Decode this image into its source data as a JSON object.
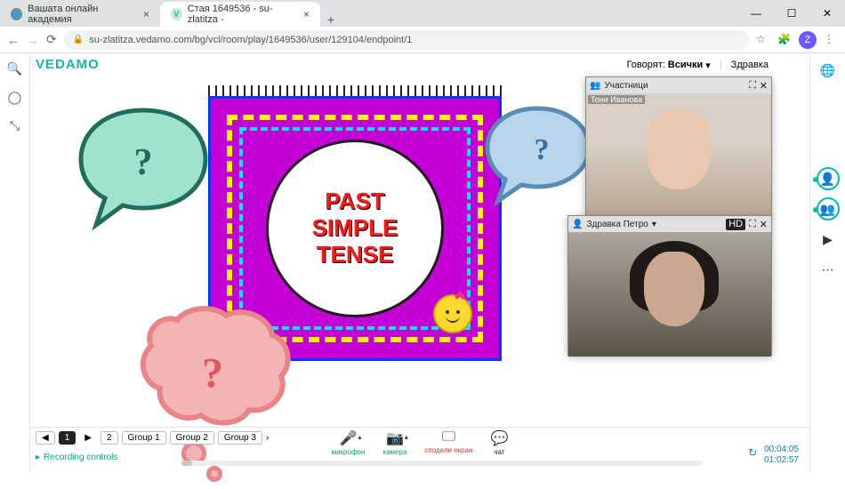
{
  "browser": {
    "tabs": [
      {
        "title": "Вашата онлайн академия",
        "favicon": "🌐"
      },
      {
        "title": "Стая 1649536 - su-zlatitza -",
        "favicon": "V"
      }
    ],
    "url": "su-zlatitza.vedamo.com/bg/vcl/room/play/1649536/user/129104/endpoint/1",
    "avatar_letter": "Z"
  },
  "app": {
    "logo": "VEDAMO",
    "speaking_label": "Говорят:",
    "speaking_value": "Всички",
    "user_short": "Здравка"
  },
  "slide": {
    "line1": "PAST",
    "line2": "SIMPLE",
    "line3": "TENSE"
  },
  "bubbles": {
    "q": "?"
  },
  "panels": {
    "p1_title": "Участници",
    "p1_caption": "Тони Иванова",
    "p2_title": "Здравка Петро",
    "hd": "HD"
  },
  "bottom": {
    "rooms": [
      "1",
      "2",
      "Group 1",
      "Group 2",
      "Group 3"
    ],
    "room_prev": "◀",
    "room_next": "▶",
    "active_room": "1",
    "rec_label": "Recording controls",
    "media": {
      "mic": "микрофон",
      "cam": "камера",
      "share": "сподели екран",
      "chat": "чат"
    },
    "time_elapsed": "00:04:05",
    "time_total": "01:02:57"
  }
}
